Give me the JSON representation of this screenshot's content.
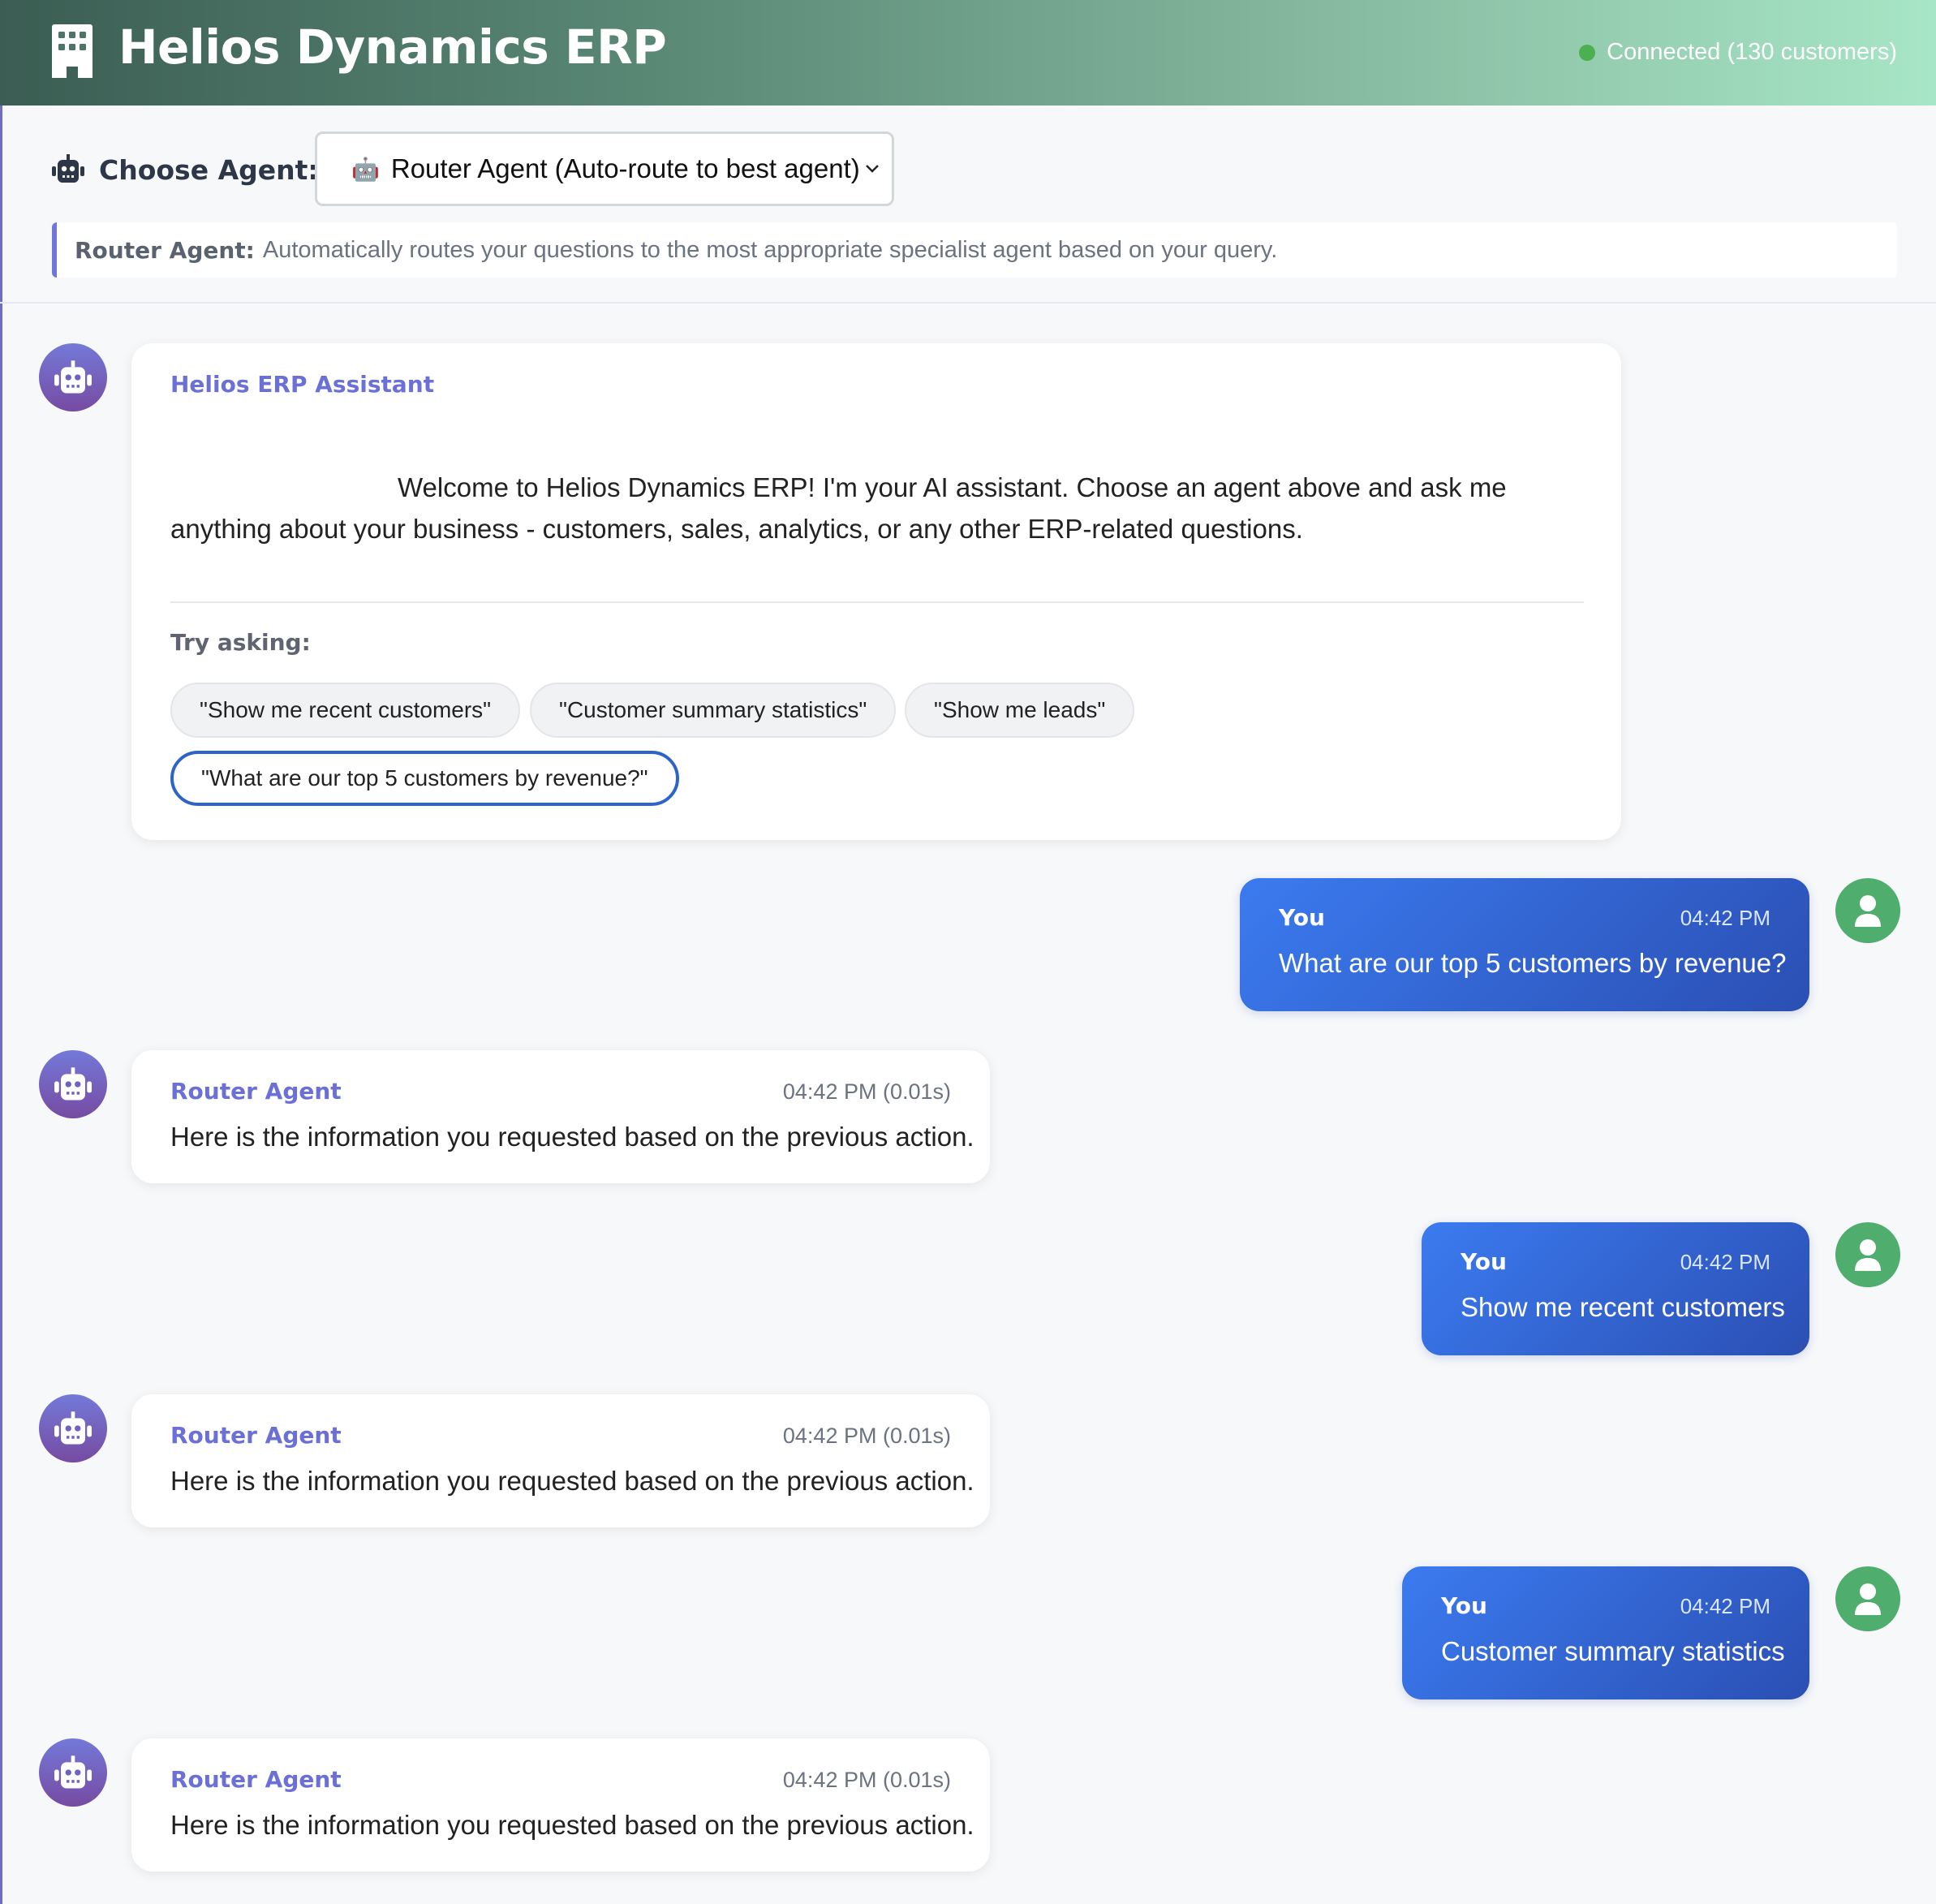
{
  "header": {
    "app_title": "Helios Dynamics ERP",
    "status_text": "Connected (130 customers)",
    "status_color": "#4caf50"
  },
  "agent_bar": {
    "label": "Choose Agent:",
    "selected_agent": "Router Agent (Auto-route to best agent)",
    "selected_agent_emoji": "🤖",
    "description_title": "Router Agent:",
    "description_text": "Automatically routes your questions to the most appropriate specialist agent based on your query."
  },
  "welcome": {
    "sender": "Helios ERP Assistant",
    "text": "Welcome to Helios Dynamics ERP! I'm your AI assistant. Choose an agent above and ask me anything about your business - customers, sales, analytics, or any other ERP-related questions.",
    "try_label": "Try asking:",
    "suggestions": [
      "\"Show me recent customers\"",
      "\"Customer summary statistics\"",
      "\"Show me leads\"",
      "\"What are our top 5 customers by revenue?\""
    ]
  },
  "messages": [
    {
      "role": "user",
      "sender": "You",
      "time": "04:42 PM",
      "text": "What are our top 5 customers by revenue?"
    },
    {
      "role": "bot",
      "sender": "Router Agent",
      "time": "04:42 PM (0.01s)",
      "text": "Here is the information you requested based on the previous action."
    },
    {
      "role": "user",
      "sender": "You",
      "time": "04:42 PM",
      "text": "Show me recent customers"
    },
    {
      "role": "bot",
      "sender": "Router Agent",
      "time": "04:42 PM (0.01s)",
      "text": "Here is the information you requested based on the previous action."
    },
    {
      "role": "user",
      "sender": "You",
      "time": "04:42 PM",
      "text": "Customer summary statistics"
    },
    {
      "role": "bot",
      "sender": "Router Agent",
      "time": "04:42 PM (0.01s)",
      "text": "Here is the information you requested based on the previous action."
    }
  ],
  "icons": {
    "logo": "building-icon",
    "agent": "robot-icon",
    "bot_avatar": "robot-icon",
    "user_avatar": "user-icon",
    "select": "chevron-down-icon"
  },
  "colors": {
    "accent": "#6b70d6",
    "user_bubble": "#3b7bf0",
    "user_avatar": "#4fad6e",
    "active_chip_border": "#2e63c9"
  }
}
